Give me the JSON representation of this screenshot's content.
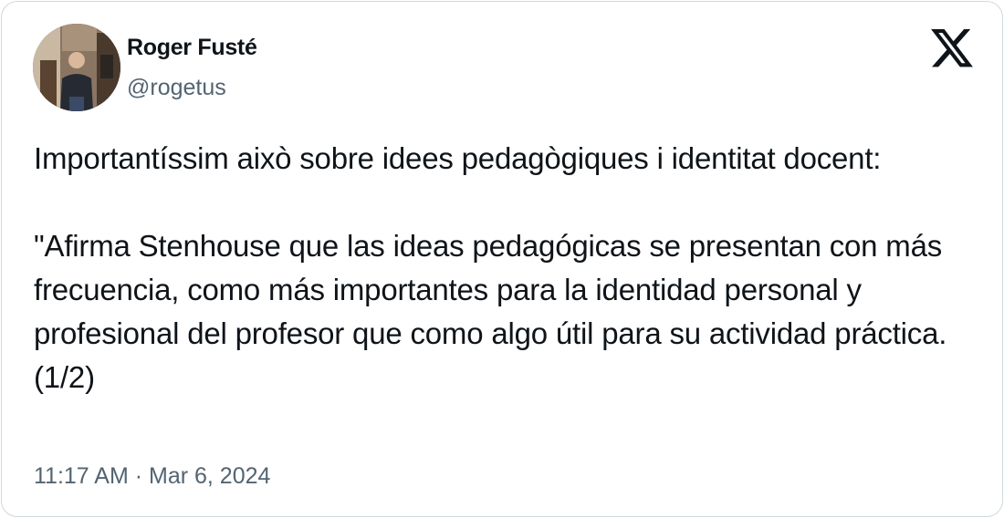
{
  "author": {
    "name": "Roger Fusté",
    "handle": "@rogetus"
  },
  "platform_icon": "x-logo-icon",
  "tweet": {
    "paragraphs": [
      "Importantíssim això sobre idees pedagògiques i identitat docent:",
      "\"Afirma Stenhouse que las ideas pedagógicas se presentan con más frecuencia, como más importantes para la identidad personal y profesional del profesor que como algo útil para su actividad práctica. (1/2)"
    ]
  },
  "timestamp": "11:17 AM · Mar 6, 2024",
  "colors": {
    "text_primary": "#0f1419",
    "text_secondary": "#536471",
    "border": "#cfd9de"
  }
}
